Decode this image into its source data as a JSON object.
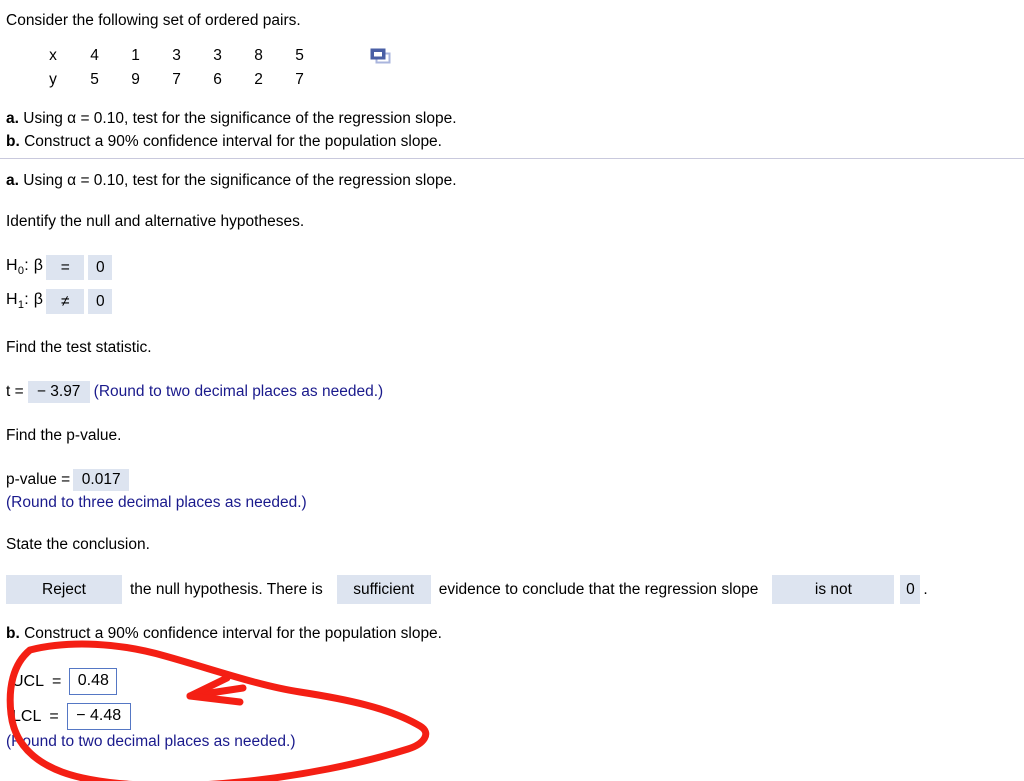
{
  "problem": {
    "prompt": "Consider the following set of ordered pairs.",
    "table": {
      "row_labels": [
        "x",
        "y"
      ],
      "x": [
        "4",
        "1",
        "3",
        "3",
        "8",
        "5"
      ],
      "y": [
        "5",
        "9",
        "7",
        "6",
        "2",
        "7"
      ]
    },
    "popout_icon": "duplicate-window-icon",
    "part_a_label": "a.",
    "part_a_text": "Using α = 0.10, test for the significance of the regression slope.",
    "part_b_label": "b.",
    "part_b_text": "Construct a 90% confidence interval for the population slope."
  },
  "work": {
    "part_a_label": "a.",
    "part_a_text": "Using α = 0.10, test for the significance of the regression slope.",
    "identify_prompt": "Identify the null and alternative hypotheses.",
    "hypotheses": {
      "null_label": "H",
      "null_sub": "0",
      "null_param": ": β",
      "null_operator": "=",
      "null_value": "0",
      "alt_label": "H",
      "alt_sub": "1",
      "alt_param": ": β",
      "alt_operator": "≠",
      "alt_value": "0"
    },
    "test_statistic": {
      "prompt": "Find the test statistic.",
      "label": "t =",
      "value": "− 3.97",
      "note": "(Round to two decimal places as needed.)"
    },
    "p_value": {
      "prompt": "Find the p-value.",
      "label": "p-value =",
      "value": "0.017",
      "note": "(Round to three decimal places as needed.)"
    },
    "conclusion": {
      "prompt": "State the conclusion.",
      "decision": "Reject",
      "text_1": "the null hypothesis. There is",
      "evidence": "sufficient",
      "text_2": "evidence to conclude that the regression slope",
      "relation": "is not",
      "compare_value": "0",
      "period": "."
    },
    "part_b_label": "b.",
    "part_b_text": "Construct a 90% confidence interval for the population slope.",
    "confidence_interval": {
      "ucl_label": "UCL",
      "ucl_eq": "=",
      "ucl_value": "0.48",
      "lcl_label": "LCL",
      "lcl_eq": "=",
      "lcl_value": "− 4.48",
      "note": "(Round to two decimal places as needed.)"
    }
  },
  "annotation": {
    "shape": "red-ink-circle-with-arrow",
    "color": "#f41f14"
  },
  "colors": {
    "field_fill": "#dde4f0",
    "field_border": "#5577c4",
    "note_text": "#1a1a8c",
    "divider": "#c9c9dd",
    "annotation_red": "#f41f14",
    "icon_dark_blue": "#4a5fa5",
    "icon_light_blue": "#aab5dd"
  }
}
